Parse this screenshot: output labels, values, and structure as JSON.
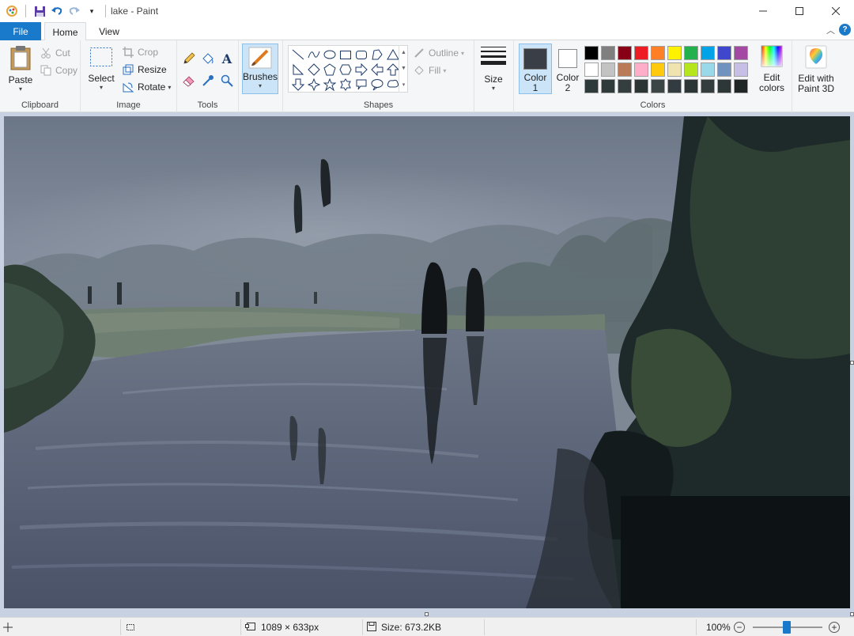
{
  "window": {
    "title": "lake - Paint"
  },
  "tabs": [
    {
      "label": "File"
    },
    {
      "label": "Home"
    },
    {
      "label": "View"
    }
  ],
  "ribbon": {
    "clipboard": {
      "group_label": "Clipboard",
      "paste": "Paste",
      "cut": "Cut",
      "copy": "Copy"
    },
    "image": {
      "group_label": "Image",
      "select": "Select",
      "crop": "Crop",
      "resize": "Resize",
      "rotate": "Rotate"
    },
    "tools": {
      "group_label": "Tools",
      "items": [
        "pencil-icon",
        "fill-bucket-icon",
        "text-icon",
        "eraser-icon",
        "color-picker-icon",
        "magnifier-icon"
      ]
    },
    "brushes": {
      "label": "Brushes"
    },
    "shapes": {
      "group_label": "Shapes",
      "outline": "Outline",
      "fill": "Fill"
    },
    "size": {
      "label": "Size"
    },
    "colors": {
      "group_label": "Colors",
      "color1_label": "Color",
      "color1_num": "1",
      "color1_value": "#3a3f47",
      "color2_label": "Color",
      "color2_num": "2",
      "color2_value": "#ffffff",
      "edit_colors_line1": "Edit",
      "edit_colors_line2": "colors",
      "palette": [
        [
          "#000000",
          "#7f7f7f",
          "#880015",
          "#ed1c24",
          "#ff7f27",
          "#fff200",
          "#22b14c",
          "#00a2e8",
          "#3f48cc",
          "#a349a4"
        ],
        [
          "#ffffff",
          "#c3c3c3",
          "#b97a57",
          "#ffaec9",
          "#ffc90e",
          "#efe4b0",
          "#b5e61d",
          "#99d9ea",
          "#7092be",
          "#c8bfe7"
        ],
        [
          "#2e3a3a",
          "#2f3b3b",
          "#343e3e",
          "#2a3434",
          "#3b4545",
          "#323c40",
          "#2b3535",
          "#333d3d",
          "#2d3737",
          "#1f2424"
        ]
      ]
    },
    "paint3d": {
      "line1": "Edit with",
      "line2": "Paint 3D"
    }
  },
  "status": {
    "dimensions": "1089 × 633px",
    "size": "Size: 673.2KB",
    "zoom": "100%"
  }
}
